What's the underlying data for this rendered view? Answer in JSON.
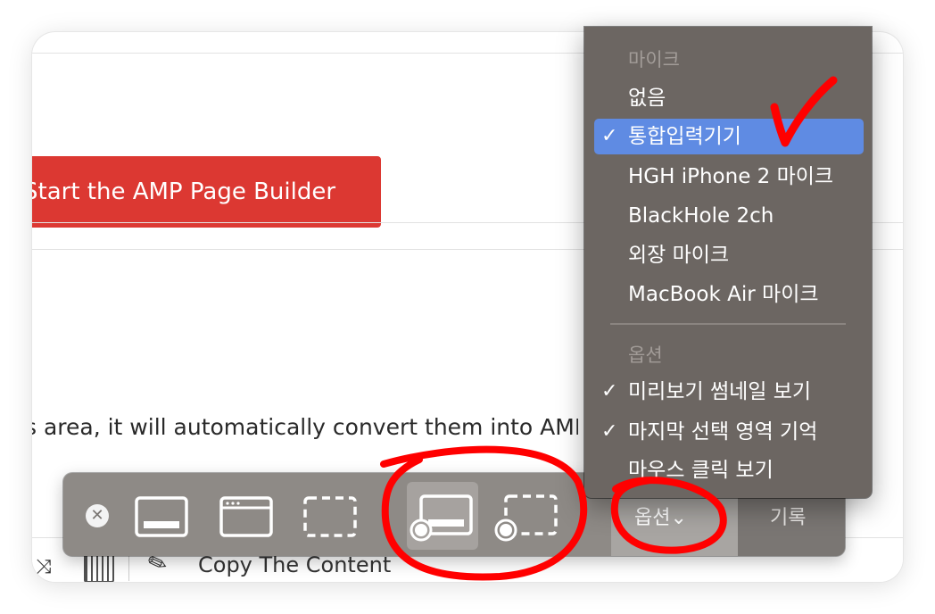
{
  "page": {
    "start_button": "Start the AMP Page Builder",
    "paragraph": "s area, it will automatically convert them into AMP co",
    "bottom_bar": {
      "copy_label": "Copy The Content"
    }
  },
  "toolbar": {
    "close_icon": "close-icon",
    "capture_modes": [
      {
        "name": "capture-screen",
        "icon": "capture-screen-icon"
      },
      {
        "name": "capture-window",
        "icon": "capture-window-icon"
      },
      {
        "name": "capture-selection",
        "icon": "capture-selection-icon"
      },
      {
        "name": "record-screen",
        "icon": "record-screen-icon",
        "active": true
      },
      {
        "name": "record-selection",
        "icon": "record-selection-icon"
      }
    ],
    "options_label": "옵션⌄",
    "record_label": "기록"
  },
  "options_menu": {
    "mic_header": "마이크",
    "mic_items": [
      {
        "label": "없음",
        "checked": false
      },
      {
        "label": "통합입력기기",
        "checked": true,
        "highlighted": true
      },
      {
        "label": "HGH iPhone 2 마이크",
        "checked": false
      },
      {
        "label": "BlackHole 2ch",
        "checked": false
      },
      {
        "label": "외장 마이크",
        "checked": false
      },
      {
        "label": "MacBook Air 마이크",
        "checked": false
      }
    ],
    "options_header": "옵션",
    "option_items": [
      {
        "label": "미리보기 썸네일 보기",
        "checked": true
      },
      {
        "label": "마지막 선택 영역 기억",
        "checked": true
      },
      {
        "label": "마우스 클릭 보기",
        "checked": false
      }
    ],
    "check_mark": "✓"
  },
  "colors": {
    "start_button": "#dc3832",
    "toolbar_bg": "#8e8a86",
    "menu_bg": "#6c6662",
    "menu_highlight": "#5f8be3",
    "annotation": "#ff0000"
  }
}
